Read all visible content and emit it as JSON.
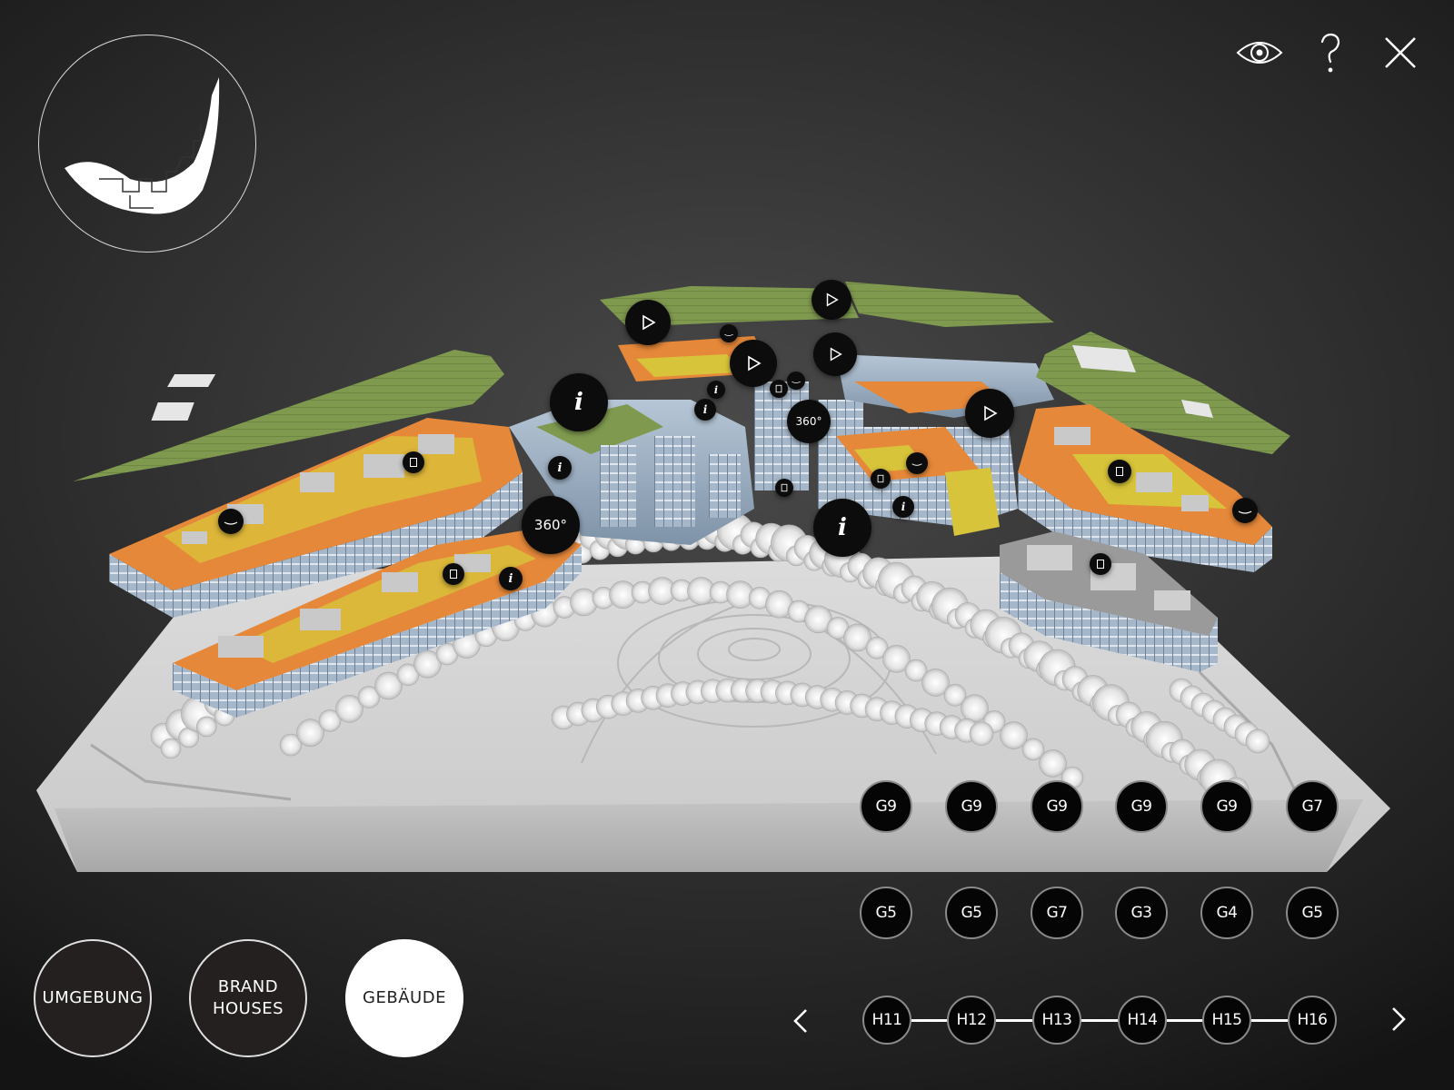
{
  "logo": {
    "icon": "campus-logo-icon"
  },
  "toolbar": {
    "view_icon": "eye-icon",
    "help_icon": "question-icon",
    "close_icon": "close-icon"
  },
  "hotspots": {
    "play_icon": "play-icon",
    "info_label": "i",
    "pano_label": "360°"
  },
  "levels": {
    "row1": [
      "G9",
      "G9",
      "G9",
      "G9",
      "G9",
      "G7"
    ],
    "row2": [
      "G5",
      "G5",
      "G7",
      "G3",
      "G4",
      "G5"
    ],
    "houses": [
      "H11",
      "H12",
      "H13",
      "H14",
      "H15",
      "H16"
    ],
    "prev_icon": "chevron-left-icon",
    "next_icon": "chevron-right-icon"
  },
  "modes": {
    "surroundings": "UMGEBUNG",
    "brand_houses": [
      "BRAND",
      "HOUSES"
    ],
    "buildings": "GEBÄUDE",
    "active": "buildings"
  },
  "colors": {
    "background": "#2e2e2e",
    "roof_green": "#7e9a4e",
    "floor_orange": "#e5883a",
    "floor_yellow": "#d8c43a",
    "facade_blue": "#9ab1c8",
    "terrain_gray": "#cfcfcf",
    "hotspot_black": "#0c0c0c",
    "active_button": "#ffffff"
  }
}
